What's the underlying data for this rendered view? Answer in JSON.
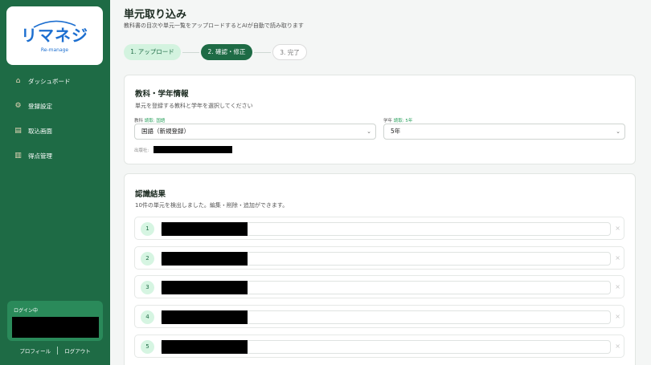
{
  "sidebar": {
    "logo": {
      "main": "リマネジ",
      "sub": "Re-manage"
    },
    "items": [
      {
        "label": "ダッシュボード",
        "icon": "house-icon"
      },
      {
        "label": "登録設定",
        "icon": "gear-icon"
      },
      {
        "label": "取込画面",
        "icon": "inbox-tray-icon"
      },
      {
        "label": "得点管理",
        "icon": "bar-chart-icon"
      }
    ],
    "login": {
      "label": "ログイン中"
    },
    "footer": {
      "profile": "プロフィール",
      "logout": "ログアウト"
    }
  },
  "page": {
    "title": "単元取り込み",
    "subtitle": "教科書の目次や単元一覧をアップロードするとAIが自動で読み取ります"
  },
  "steps": [
    "1. アップロード",
    "2. 確認・修正",
    "3. 完了"
  ],
  "subject_card": {
    "title": "教科・学年情報",
    "desc": "単元を登録する教科と学年を選択してください",
    "subject_label": "教科",
    "subject_detected": "読取: 国語",
    "subject_value": "国語（新規登録）",
    "grade_label": "学年",
    "grade_detected": "読取: 5年",
    "grade_value": "5年",
    "publisher_label": "出版社:"
  },
  "result_card": {
    "title": "認識結果",
    "desc": "10件の単元を検出しました。編集・削除・追加ができます。",
    "rows": [
      {
        "num": "1"
      },
      {
        "num": "2"
      },
      {
        "num": "3"
      },
      {
        "num": "4"
      },
      {
        "num": "5"
      }
    ],
    "delete_symbol": "×"
  },
  "colors": {
    "sidebar": "#1e6b45",
    "accent": "#1e6b45",
    "accent_light": "#d3f3df",
    "logo": "#1d6fd0"
  }
}
